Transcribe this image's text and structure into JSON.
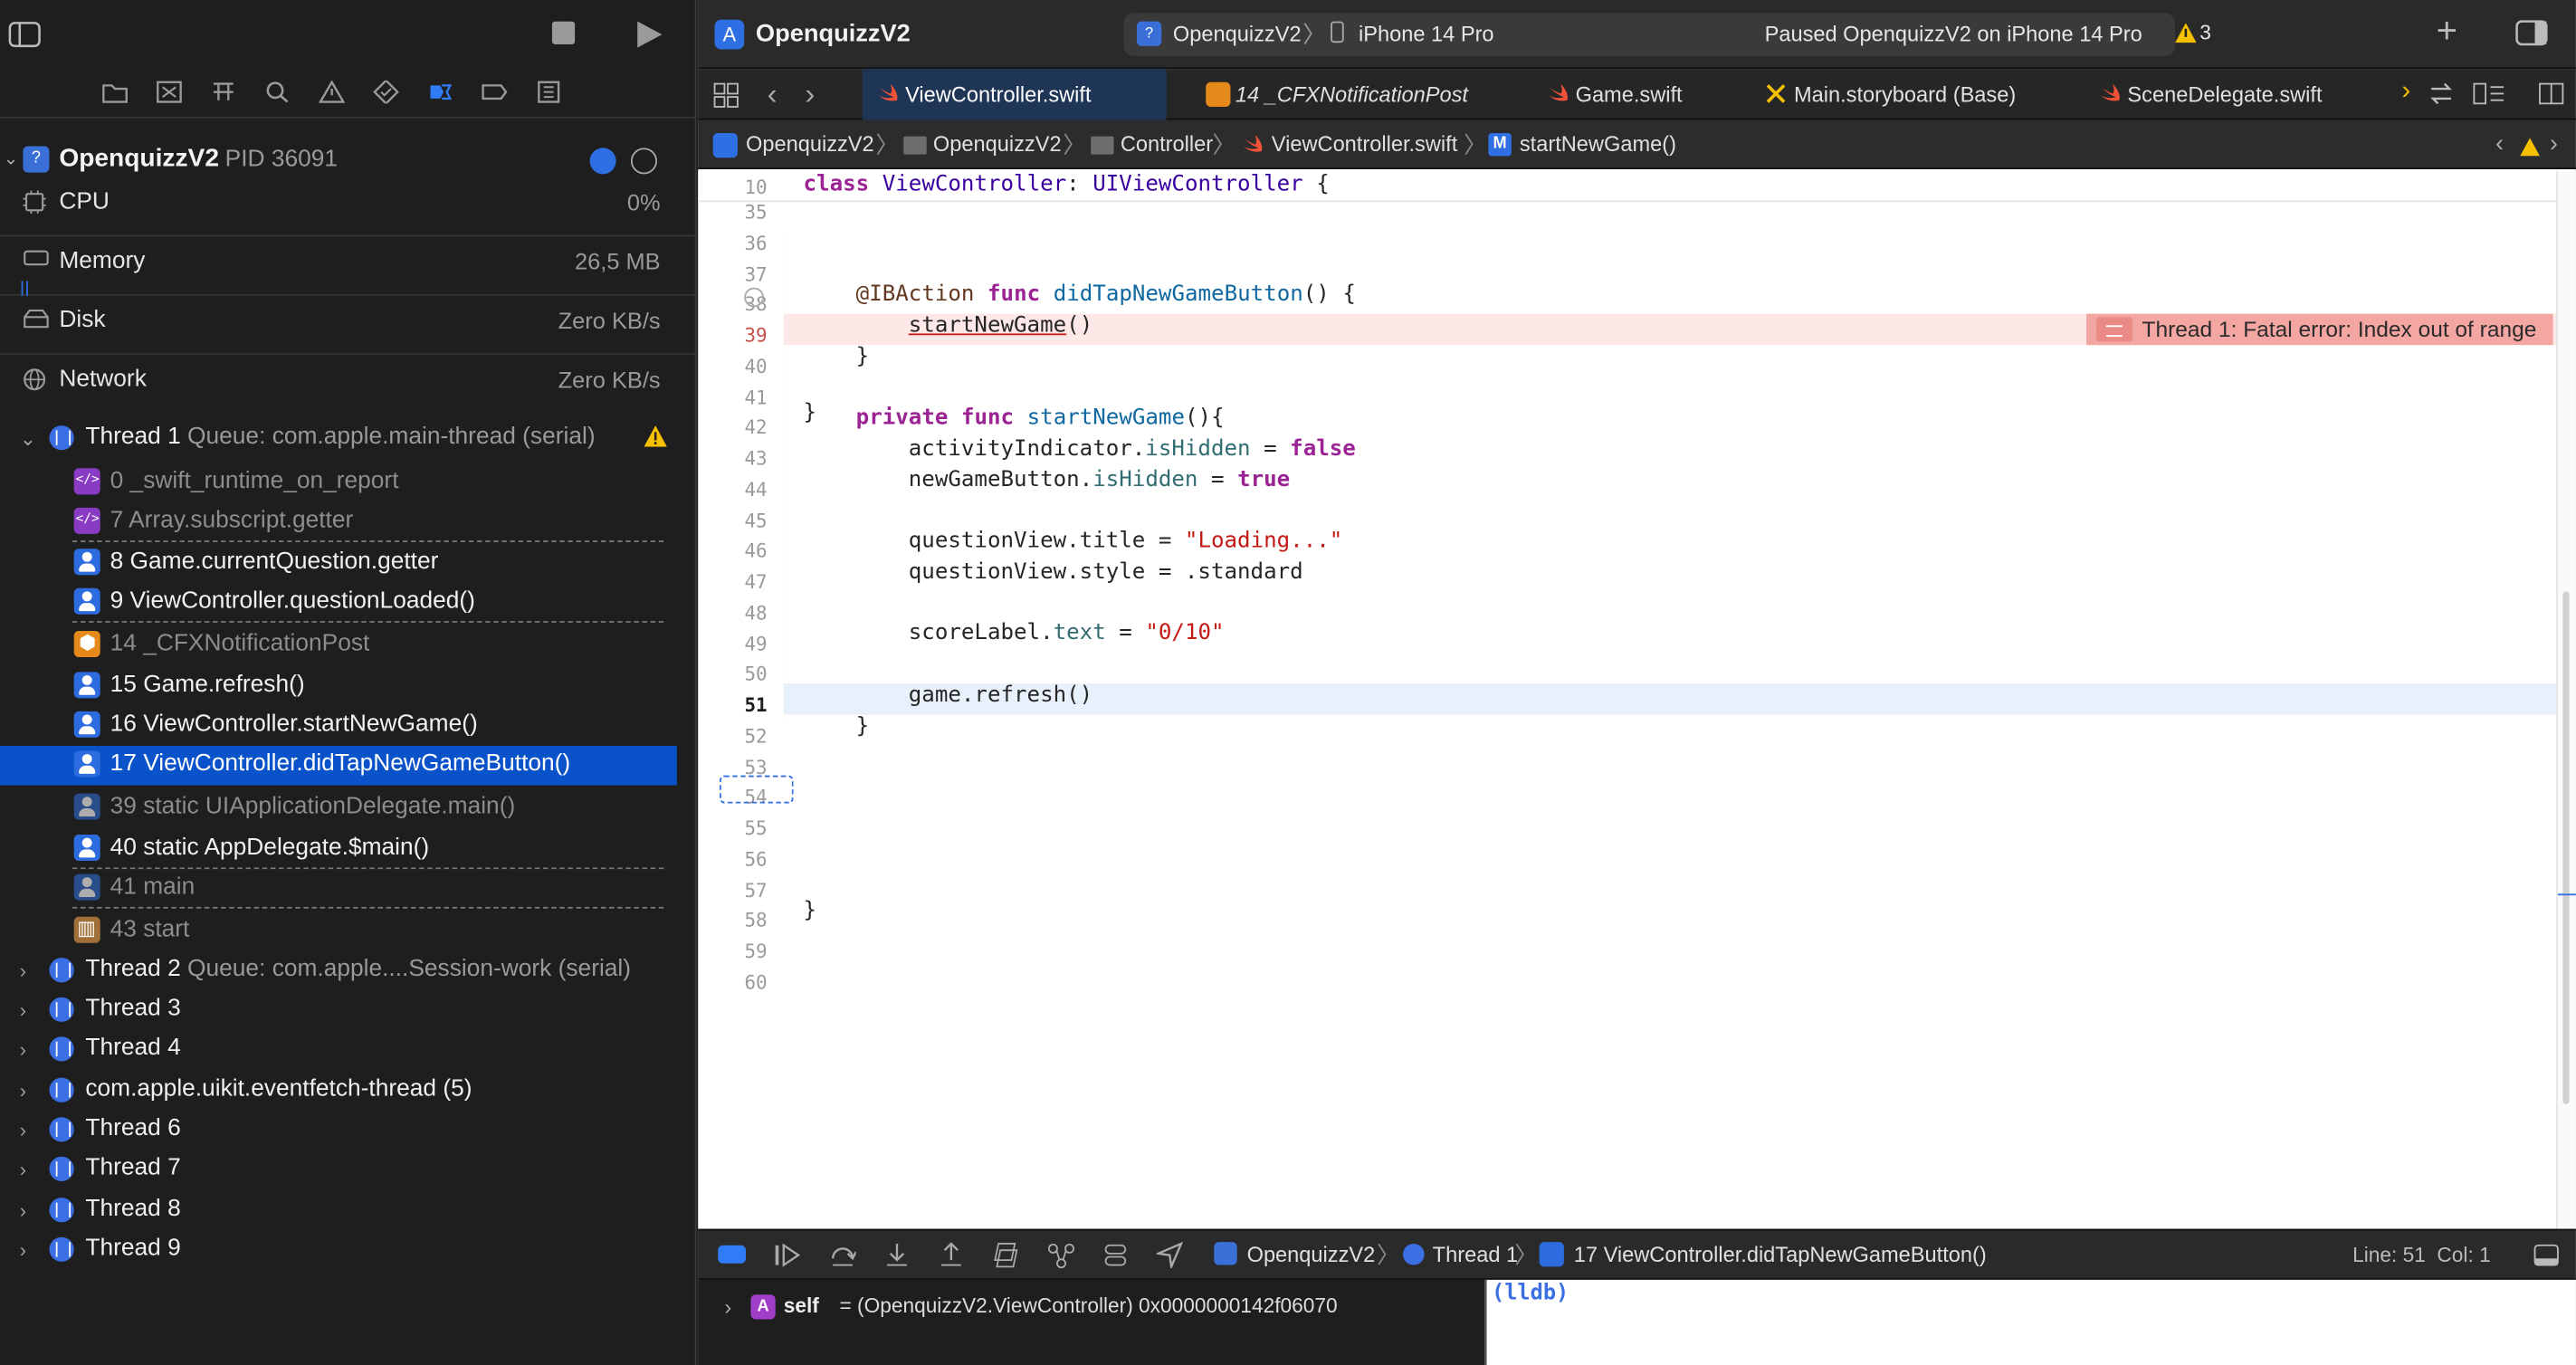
{
  "sidebar": {
    "process": {
      "name": "OpenquizzV2",
      "pid": "PID 36091"
    },
    "gauges": [
      {
        "label": "CPU",
        "value": "0%"
      },
      {
        "label": "Memory",
        "value": "26,5 MB"
      },
      {
        "label": "Disk",
        "value": "Zero KB/s"
      },
      {
        "label": "Network",
        "value": "Zero KB/s"
      }
    ],
    "thread1": {
      "name": "Thread 1",
      "queue": "Queue: com.apple.main-thread (serial)"
    },
    "frames": [
      {
        "text": "0 _swift_runtime_on_report",
        "kind": "sys"
      },
      {
        "text": "7 Array.subscript.getter",
        "kind": "sys"
      },
      {
        "text": "8 Game.currentQuestion.getter",
        "kind": "user"
      },
      {
        "text": "9 ViewController.questionLoaded()",
        "kind": "user"
      },
      {
        "text": "14 _CFXNotificationPost",
        "kind": "cf"
      },
      {
        "text": "15 Game.refresh()",
        "kind": "user"
      },
      {
        "text": "16 ViewController.startNewGame()",
        "kind": "user"
      },
      {
        "text": "17 ViewController.didTapNewGameButton()",
        "kind": "user"
      },
      {
        "text": "39 static UIApplicationDelegate.main()",
        "kind": "userdim"
      },
      {
        "text": "40 static AppDelegate.$main()",
        "kind": "user"
      },
      {
        "text": "41 main",
        "kind": "userdim"
      },
      {
        "text": "43 start",
        "kind": "lib"
      }
    ],
    "thread2": {
      "name": "Thread 2",
      "queue": "Queue: com.apple....Session-work (serial)"
    },
    "threads": [
      "Thread 3",
      "Thread 4",
      "com.apple.uikit.eventfetch-thread (5)",
      "Thread 6",
      "Thread 7",
      "Thread 8",
      "Thread 9"
    ]
  },
  "toolbar": {
    "project_title": "OpenquizzV2",
    "scheme": "OpenquizzV2",
    "device": "iPhone 14 Pro",
    "status": "Paused OpenquizzV2 on iPhone 14 Pro",
    "warning_count": "3"
  },
  "tabs": [
    {
      "label": "ViewController.swift"
    },
    {
      "label": "14 _CFXNotificationPost"
    },
    {
      "label": "Game.swift"
    },
    {
      "label": "Main.storyboard (Base)"
    },
    {
      "label": "SceneDelegate.swift"
    }
  ],
  "jumpbar": {
    "project": "OpenquizzV2",
    "group": "OpenquizzV2",
    "folder": "Controller",
    "file": "ViewController.swift",
    "method_badge": "M",
    "method": "startNewGame()"
  },
  "editor": {
    "sticky_line": "10",
    "line_numbers": [
      "35",
      "36",
      "37",
      "38",
      "39",
      "40",
      "41",
      "42",
      "43",
      "44",
      "45",
      "46",
      "47",
      "48",
      "49",
      "50",
      "51",
      "52",
      "53",
      "54",
      "55",
      "56",
      "57",
      "58",
      "59",
      "60"
    ],
    "error_message": "Thread 1: Fatal error: Index out of range"
  },
  "debugbar": {
    "project": "OpenquizzV2",
    "thread": "Thread 1",
    "frame": "17 ViewController.didTapNewGameButton()",
    "position": "Line: 51  Col: 1"
  },
  "variables": {
    "badge": "A",
    "name": "self",
    "value": "= (OpenquizzV2.ViewController) 0x0000000142f06070"
  },
  "console": {
    "prompt": "(lldb)"
  }
}
